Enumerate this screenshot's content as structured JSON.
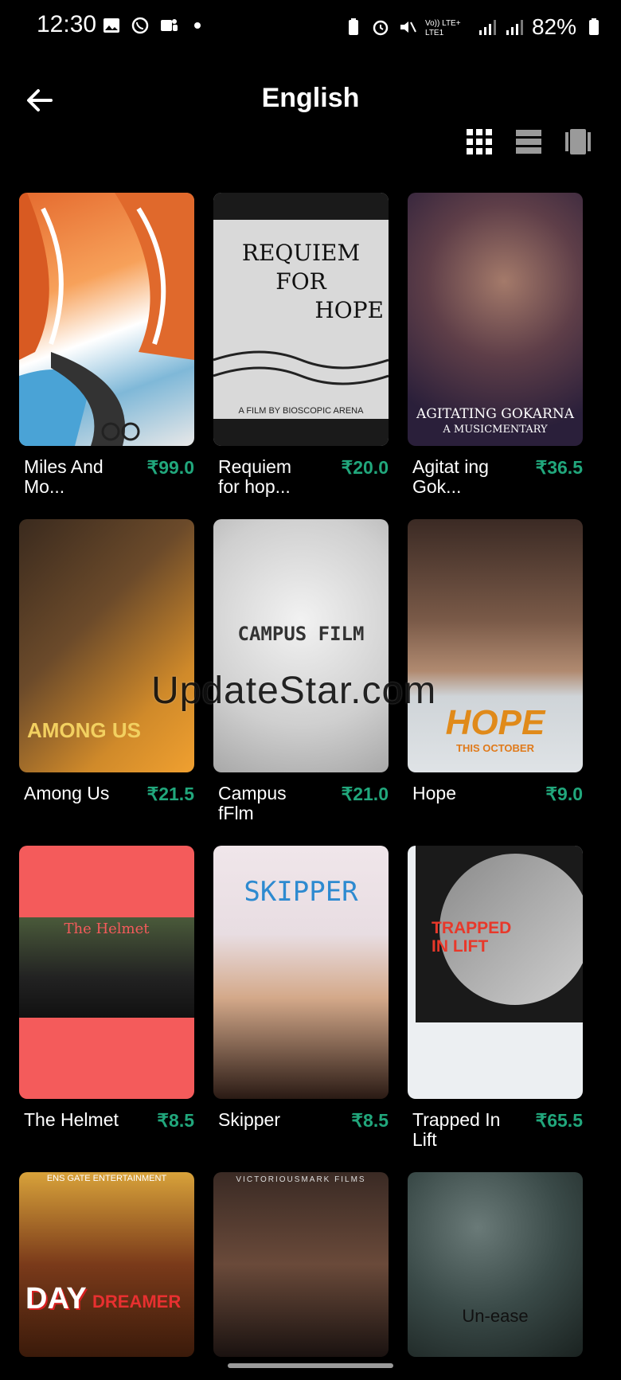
{
  "status_bar": {
    "time": "12:30",
    "battery": "82%",
    "network": "Vo)) LTE+ LTE1"
  },
  "header": {
    "title": "English",
    "back_icon": "arrow-left-icon"
  },
  "view_toggles": [
    "grid-view-icon",
    "list-view-icon",
    "carousel-view-icon"
  ],
  "movies": [
    {
      "title": "Miles And Mo...",
      "price": "₹99.0"
    },
    {
      "title": "Requiem for hop...",
      "price": "₹20.0",
      "poster_text": [
        "REQUIEM",
        "FOR",
        "HOPE"
      ],
      "poster_credit": "A FILM BY BIOSCOPIC ARENA"
    },
    {
      "title": "Agitat ing Gok...",
      "price": "₹36.5",
      "poster_text": [
        "AGITATING GOKARNA",
        "A MUSICMENTARY"
      ]
    },
    {
      "title": "Among Us",
      "price": "₹21.5",
      "poster_text": [
        "AMONG US"
      ]
    },
    {
      "title": "Campus fFlm",
      "price": "₹21.0",
      "poster_text": [
        "CAMPUS FILM"
      ]
    },
    {
      "title": "Hope",
      "price": "₹9.0",
      "poster_text": [
        "HOPE",
        "THIS OCTOBER"
      ]
    },
    {
      "title": "The Helmet",
      "price": "₹8.5",
      "poster_text": [
        "The Helmet"
      ]
    },
    {
      "title": "Skipper",
      "price": "₹8.5",
      "poster_text": [
        "SKIPPER"
      ]
    },
    {
      "title": "Trapped In Lift",
      "price": "₹65.5",
      "poster_text": [
        "TRAPPED",
        "IN LIFT"
      ]
    },
    {
      "title": "",
      "price": "",
      "poster_text": [
        "DAY",
        "DREAMER"
      ],
      "poster_credit": "ENS GATE ENTERTAINMENT"
    },
    {
      "title": "",
      "price": "",
      "poster_text": [
        "VICTORIOUSMARK FILMS"
      ]
    },
    {
      "title": "",
      "price": "",
      "poster_text": [
        "Un-ease"
      ]
    }
  ],
  "watermark": "UpdateStar.com"
}
